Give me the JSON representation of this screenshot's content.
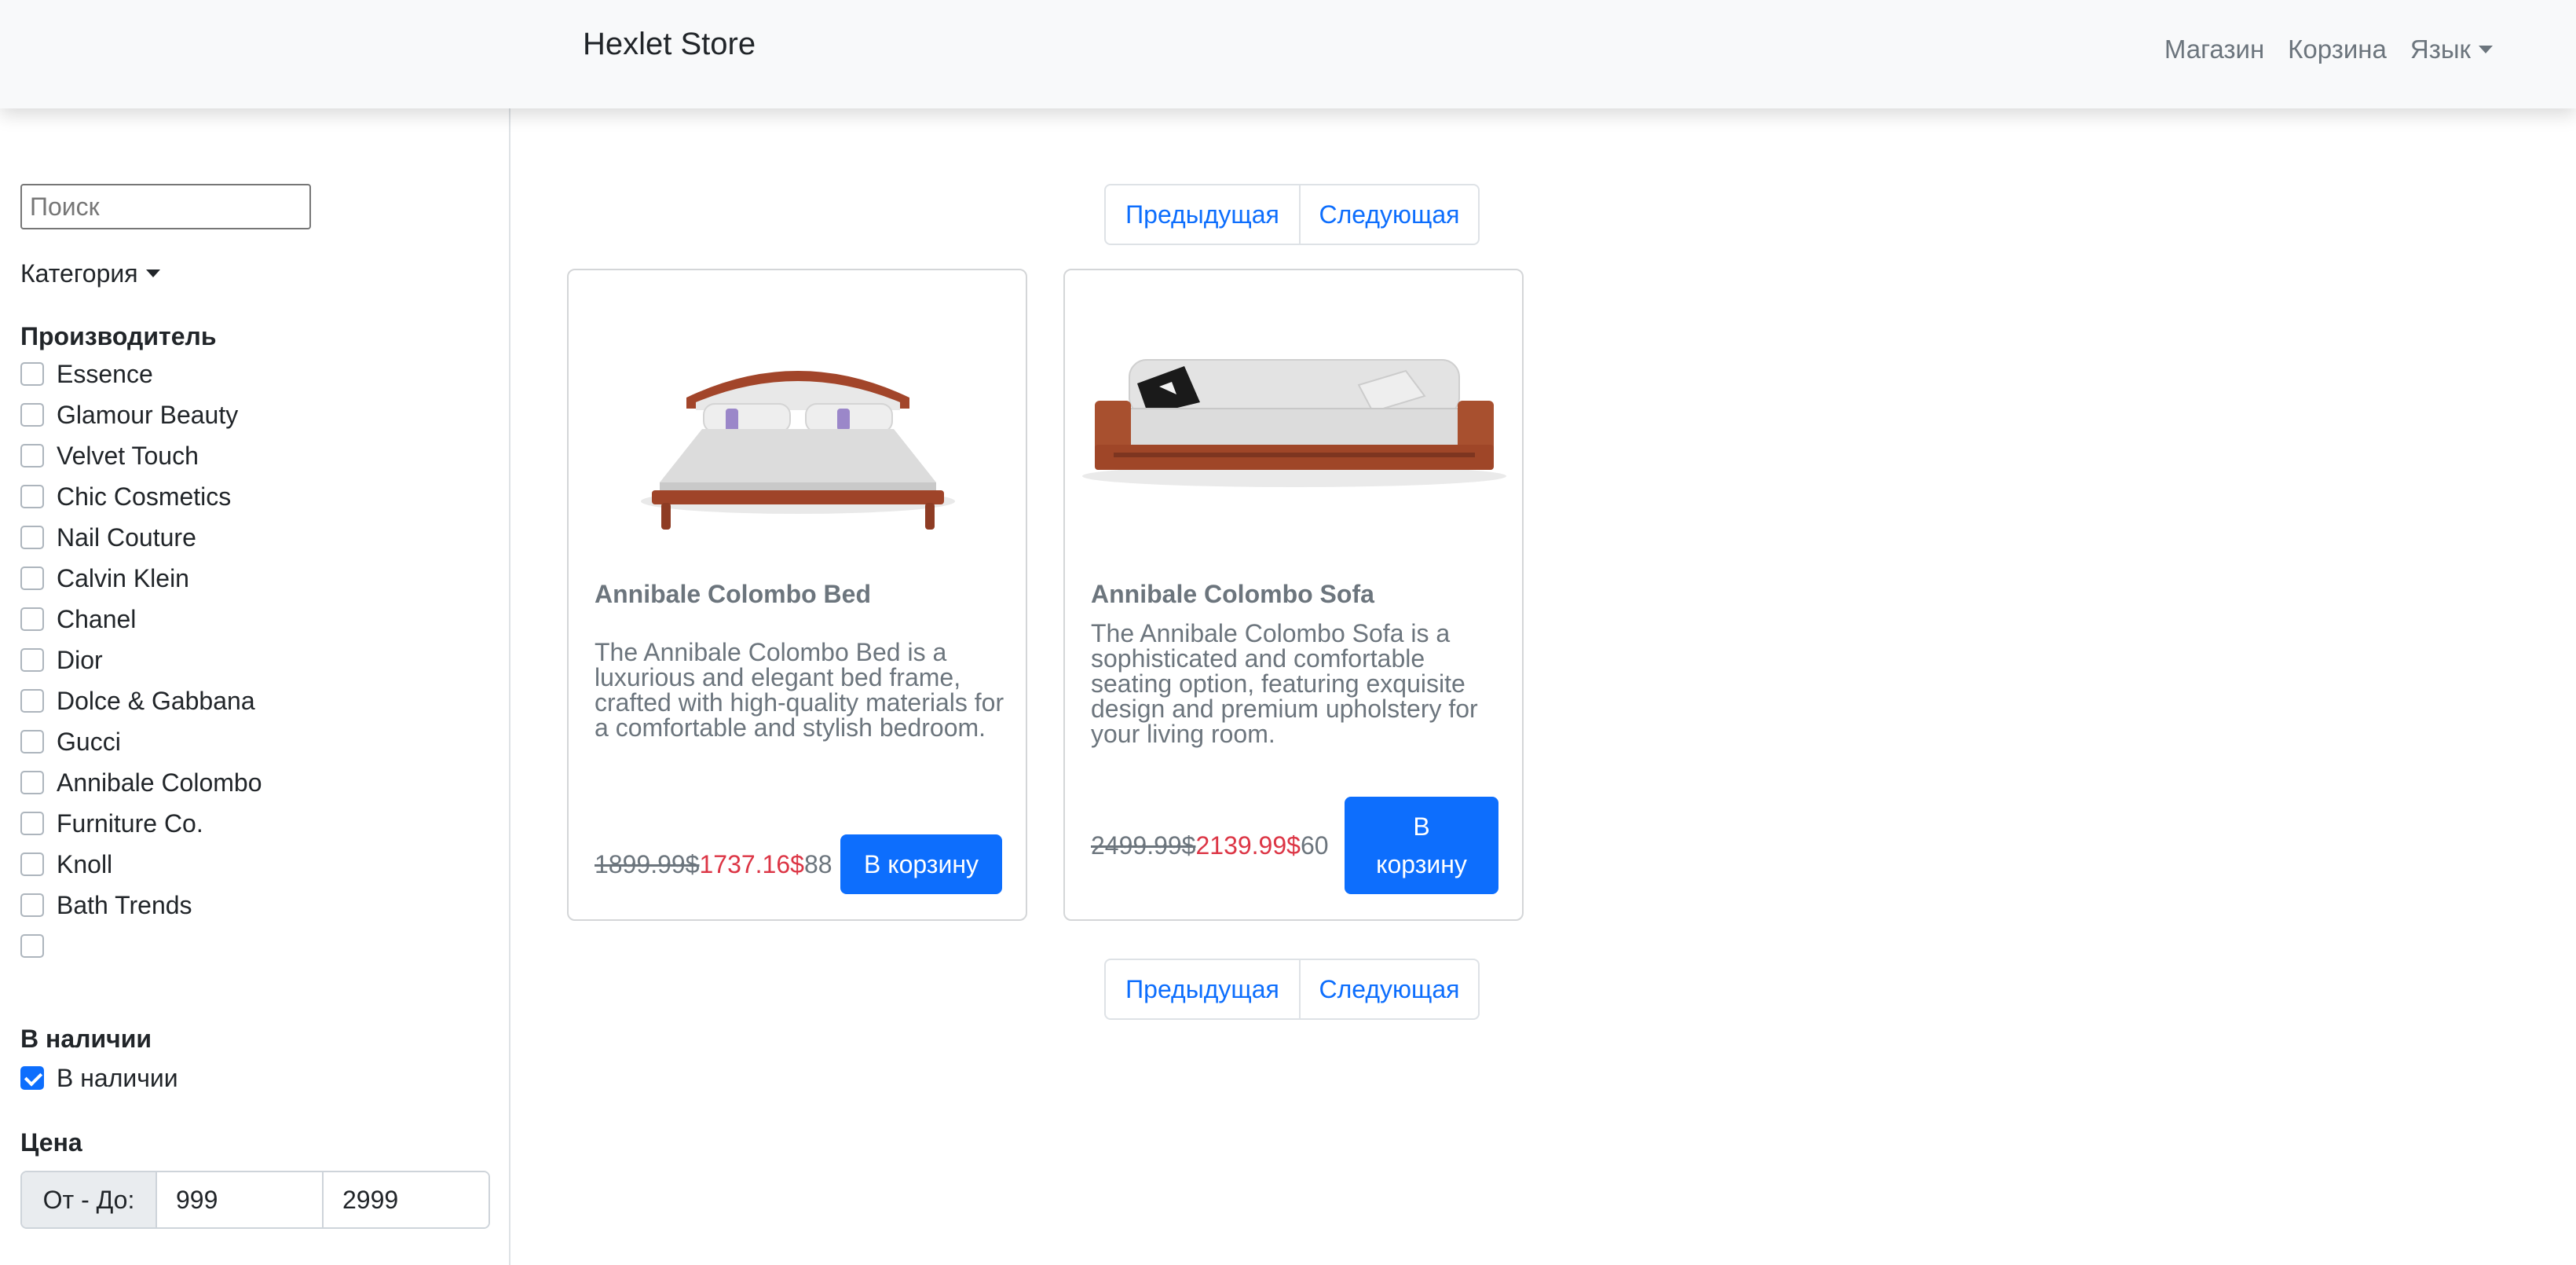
{
  "navbar": {
    "brand": "Hexlet Store",
    "links": [
      "Магазин",
      "Корзина"
    ],
    "language_label": "Язык"
  },
  "sidebar": {
    "search_placeholder": "Поиск",
    "category_label": "Категория",
    "manufacturer_heading": "Производитель",
    "manufacturers": [
      "Essence",
      "Glamour Beauty",
      "Velvet Touch",
      "Chic Cosmetics",
      "Nail Couture",
      "Calvin Klein",
      "Chanel",
      "Dior",
      "Dolce & Gabbana",
      "Gucci",
      "Annibale Colombo",
      "Furniture Co.",
      "Knoll",
      "Bath Trends",
      ""
    ],
    "availability_heading": "В наличии",
    "availability_option": "В наличии",
    "availability_checked": true,
    "price_heading": "Цена",
    "price_prefix": "От - До:",
    "price_min": "999",
    "price_max": "2999"
  },
  "pagination": {
    "prev_label": "Предыдущая",
    "next_label": "Следующая"
  },
  "products": [
    {
      "title": "Annibale Colombo Bed",
      "description": "The Annibale Colombo Bed is a luxurious and elegant bed frame, crafted with high-quality materials for a comfortable and stylish bedroom.",
      "old_price": "1899.99$",
      "new_price": "1737.16$",
      "stock": "88",
      "button_label": "В корзину",
      "image_icon": "bed-image"
    },
    {
      "title": "Annibale Colombo Sofa",
      "description": "The Annibale Colombo Sofa is a sophisticated and comfortable seating option, featuring exquisite design and premium upholstery for your living room.",
      "old_price": "2499.99$",
      "new_price": "2139.99$",
      "stock": "60",
      "button_label": "В корзину",
      "image_icon": "sofa-image"
    }
  ],
  "colors": {
    "primary": "#0d6efd",
    "sale_price": "#dc3545",
    "muted_text": "#6c757d",
    "navbar_bg": "#f8f9fa"
  }
}
